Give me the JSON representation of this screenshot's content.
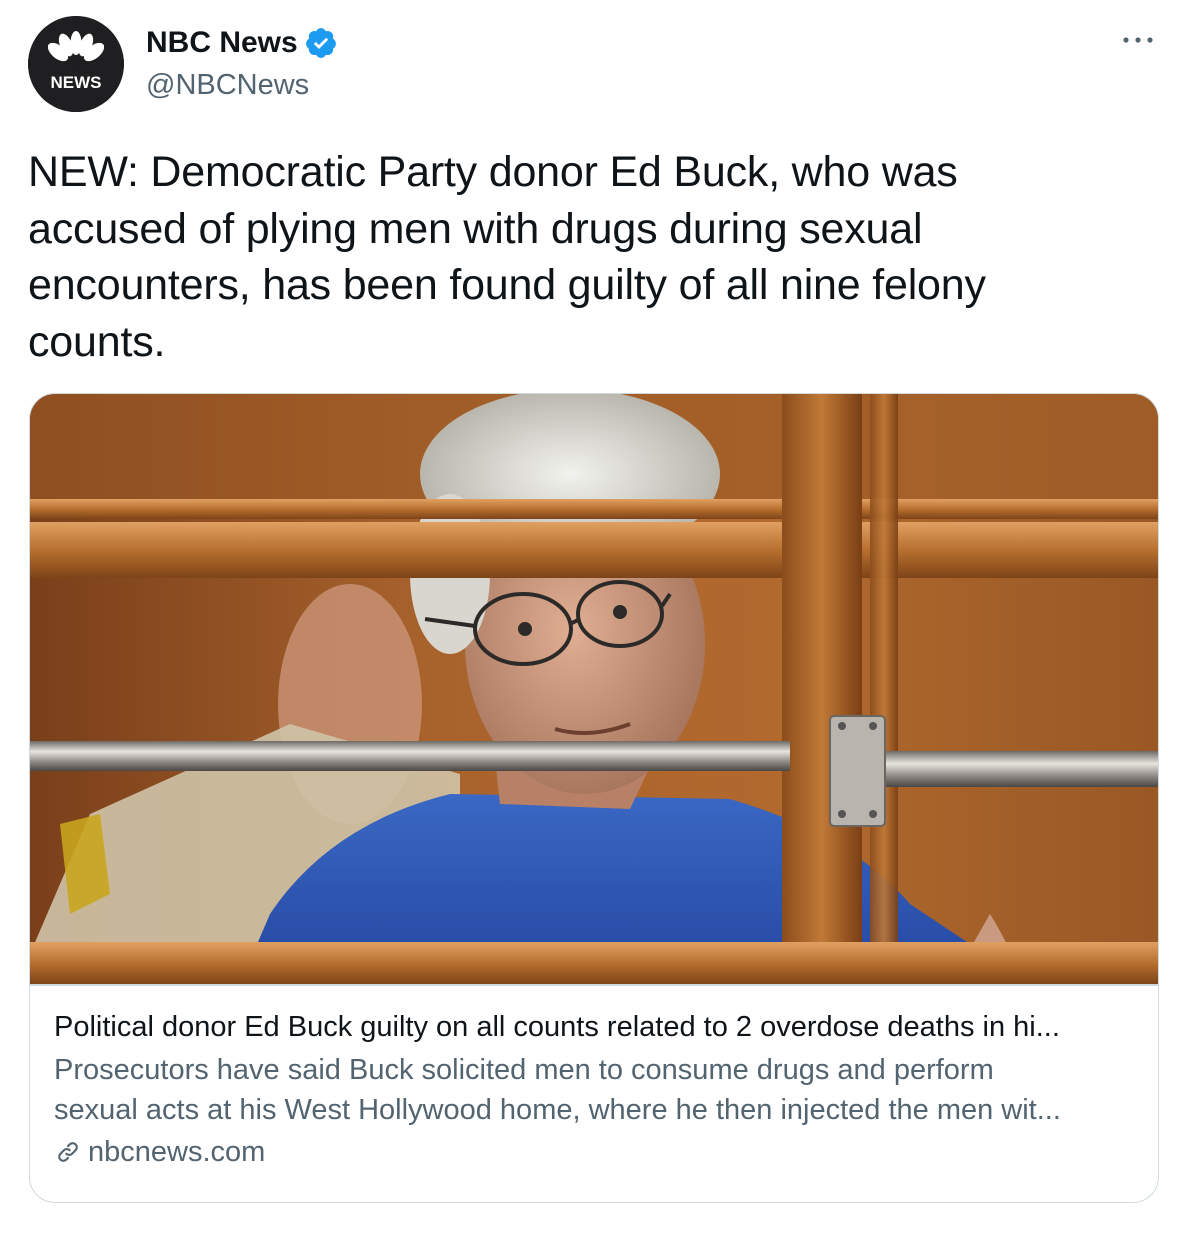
{
  "account": {
    "display_name": "NBC News",
    "handle": "@NBCNews",
    "avatar_text": "NEWS",
    "verified": true
  },
  "tweet": {
    "text_lines": [
      "NEW: Democratic Party donor Ed Buck, who was",
      "accused of plying men with drugs during sexual",
      "encounters, has been found guilty of all nine felony",
      "counts."
    ]
  },
  "card": {
    "title": "Political donor Ed Buck guilty on all counts related to 2 overdose deaths in hi...",
    "description_lines": [
      "Prosecutors have said Buck solicited men to consume drugs and perform",
      "sexual acts at his West Hollywood home, where he then injected the men wit..."
    ],
    "domain": "nbcnews.com",
    "image_icon": "courtroom-photo"
  },
  "icons": {
    "more": "more-options-icon",
    "verified": "verified-badge-icon",
    "link": "link-icon"
  },
  "colors": {
    "verified_blue": "#1d9bf0",
    "secondary_text": "#536471",
    "border": "#cfd9de"
  }
}
